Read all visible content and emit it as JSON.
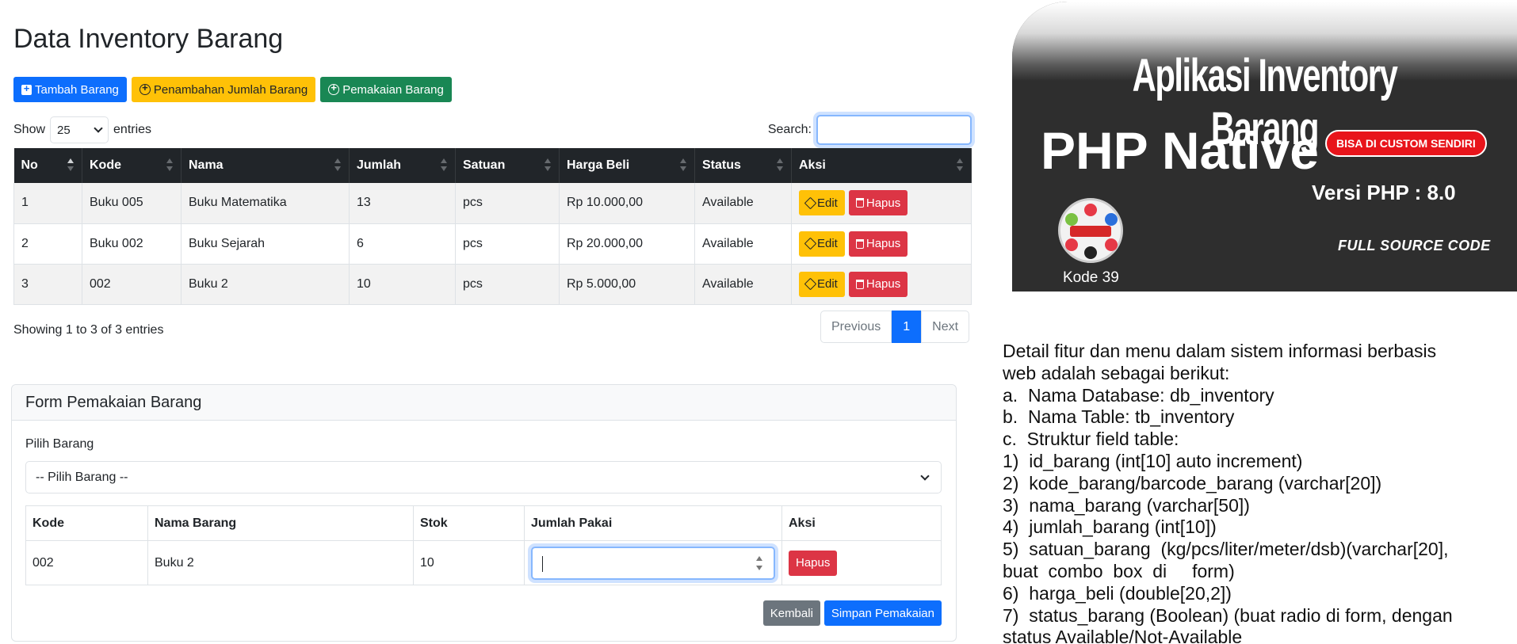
{
  "page": {
    "title": "Data Inventory Barang"
  },
  "toolbar": {
    "tambah": "Tambah Barang",
    "penambahan": "Penambahan Jumlah Barang",
    "pemakaian": "Pemakaian Barang"
  },
  "datatable": {
    "show_label": "Show",
    "entries_label": "entries",
    "length_value": "25",
    "search_label": "Search:",
    "search_value": "",
    "columns": [
      "No",
      "Kode",
      "Nama",
      "Jumlah",
      "Satuan",
      "Harga Beli",
      "Status",
      "Aksi"
    ],
    "rows": [
      {
        "no": "1",
        "kode": "Buku 005",
        "nama": "Buku Matematika",
        "jumlah": "13",
        "satuan": "pcs",
        "harga": "Rp 10.000,00",
        "status": "Available"
      },
      {
        "no": "2",
        "kode": "Buku 002",
        "nama": "Buku Sejarah",
        "jumlah": "6",
        "satuan": "pcs",
        "harga": "Rp 20.000,00",
        "status": "Available"
      },
      {
        "no": "3",
        "kode": "002",
        "nama": "Buku 2",
        "jumlah": "10",
        "satuan": "pcs",
        "harga": "Rp 5.000,00",
        "status": "Available"
      }
    ],
    "edit_label": "Edit",
    "hapus_label": "Hapus",
    "info": "Showing 1 to 3 of 3 entries",
    "pagination": {
      "previous": "Previous",
      "current": "1",
      "next": "Next"
    }
  },
  "form": {
    "title": "Form Pemakaian Barang",
    "select_label": "Pilih Barang",
    "select_value": "-- Pilih Barang --",
    "columns": [
      "Kode",
      "Nama Barang",
      "Stok",
      "Jumlah Pakai",
      "Aksi"
    ],
    "row": {
      "kode": "002",
      "nama": "Buku 2",
      "stok": "10",
      "jumlah_pakai": ""
    },
    "hapus_label": "Hapus",
    "kembali_label": "Kembali",
    "simpan_label": "Simpan Pemakaian"
  },
  "promo": {
    "title": "Aplikasi Inventory Barang",
    "php": "PHP Native",
    "badge": "BISA DI CUSTOM SENDIRI",
    "versi": "Versi PHP : 8.0",
    "full": "FULL SOURCE CODE",
    "code": "Kode 39"
  },
  "detail": {
    "lines": [
      "Detail fitur dan menu dalam sistem informasi berbasis",
      "web adalah sebagai berikut:",
      "a.  Nama Database: db_inventory",
      "b.  Nama Table: tb_inventory",
      "c.  Struktur field table:",
      "1)  id_barang (int[10] auto increment)",
      "2)  kode_barang/barcode_barang (varchar[20])",
      "3)  nama_barang (varchar[50])",
      "4)  jumlah_barang (int[10])",
      "5)  satuan_barang  (kg/pcs/liter/meter/dsb)(varchar[20],",
      "buat  combo  box  di     form)",
      "6)  harga_beli (double[20,2])",
      "7)  status_barang (Boolean) (buat radio di form, dengan",
      "status Available/Not-Available"
    ]
  },
  "colors": {
    "primary": "#0d6efd",
    "warning": "#ffc107",
    "success": "#198754",
    "danger": "#dc3545",
    "secondary": "#6c757d",
    "table_head": "#212529"
  }
}
